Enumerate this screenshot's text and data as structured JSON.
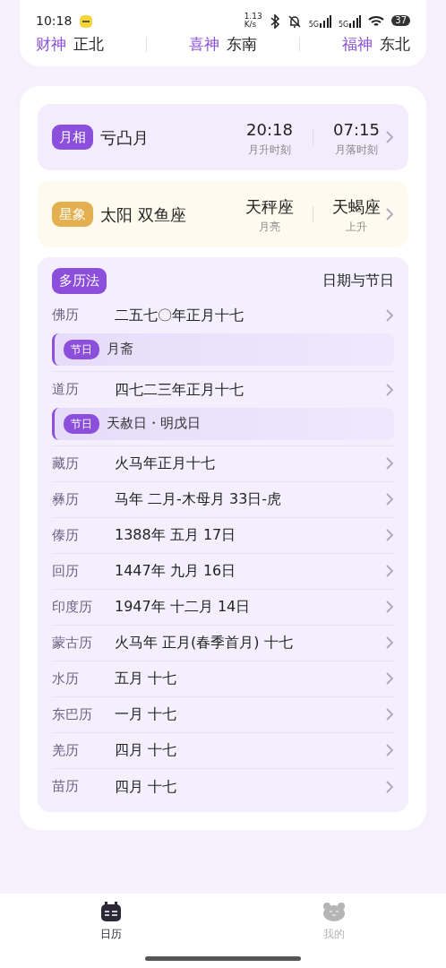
{
  "status_bar": {
    "time": "10:18",
    "net_speed": "1.13",
    "net_unit": "K/s",
    "signals": [
      "5G",
      "5G"
    ],
    "battery": "37"
  },
  "gods": [
    {
      "label": "财神",
      "direction": "正北"
    },
    {
      "label": "喜神",
      "direction": "东南"
    },
    {
      "label": "福神",
      "direction": "东北"
    }
  ],
  "moon": {
    "badge": "月相",
    "phase": "亏凸月",
    "times": [
      {
        "value": "20:18",
        "label": "月升时刻"
      },
      {
        "value": "07:15",
        "label": "月落时刻"
      }
    ]
  },
  "stars": {
    "badge": "星象",
    "sun": "太阳 双鱼座",
    "signs": [
      {
        "value": "天秤座",
        "label": "月亮"
      },
      {
        "value": "天蝎座",
        "label": "上升"
      }
    ]
  },
  "calendars": {
    "badge": "多历法",
    "link": "日期与节日",
    "rows": [
      {
        "name": "佛历",
        "date": "二五七〇年正月十七",
        "festival": {
          "tag": "节日",
          "text": "月斋"
        }
      },
      {
        "name": "道历",
        "date": "四七二三年正月十七",
        "festival": {
          "tag": "节日",
          "text": "天赦日・明戊日"
        }
      },
      {
        "name": "藏历",
        "date": "火马年正月十七"
      },
      {
        "name": "彝历",
        "date": "马年 二月-木母月 33日-虎"
      },
      {
        "name": "傣历",
        "date": "1388年 五月 17日"
      },
      {
        "name": "回历",
        "date": "1447年 九月 16日"
      },
      {
        "name": "印度历",
        "date": "1947年 十二月 14日"
      },
      {
        "name": "蒙古历",
        "date": "火马年 正月(春季首月) 十七"
      },
      {
        "name": "水历",
        "date": "五月 十七"
      },
      {
        "name": "东巴历",
        "date": "一月 十七"
      },
      {
        "name": "羌历",
        "date": "四月 十七"
      },
      {
        "name": "苗历",
        "date": "四月 十七"
      }
    ]
  },
  "tabs": [
    {
      "label": "日历",
      "kind": "calendar",
      "selected": true
    },
    {
      "label": "我的",
      "kind": "bear",
      "selected": false
    }
  ]
}
